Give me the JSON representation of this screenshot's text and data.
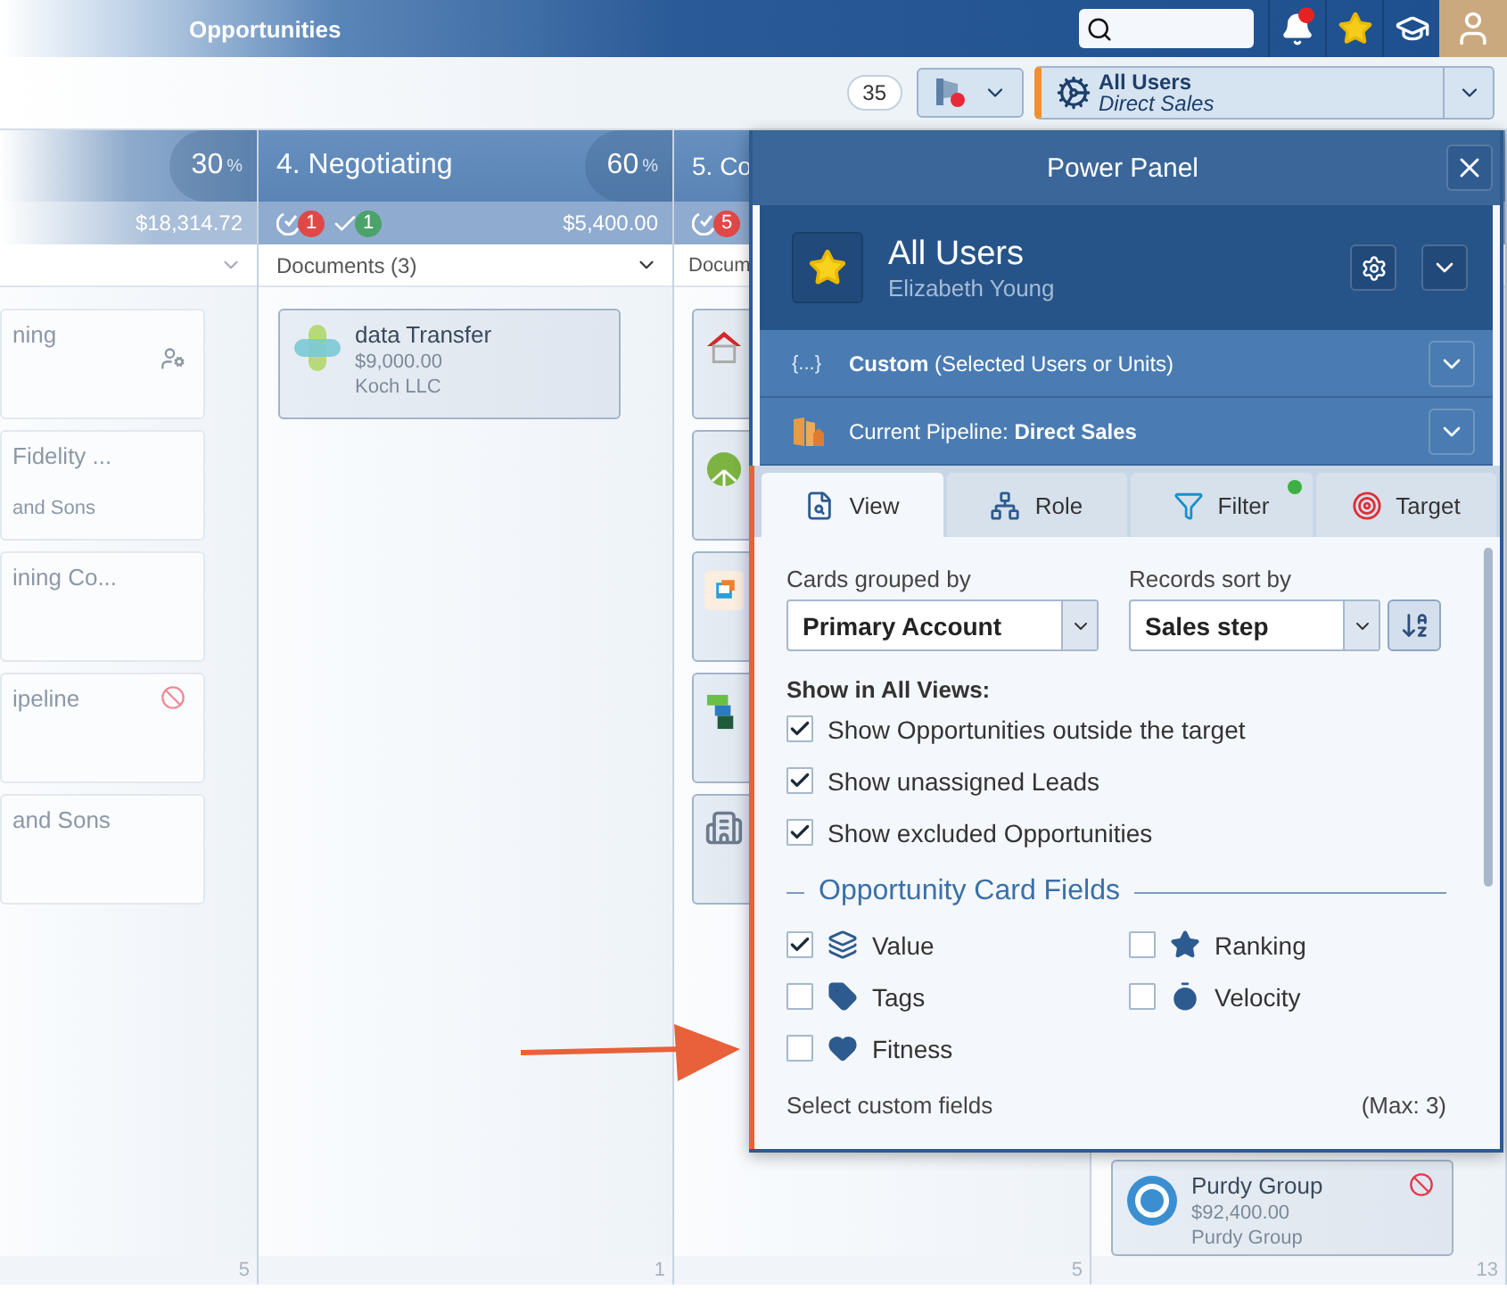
{
  "app_bar": {
    "title": "Opportunities",
    "notifications": {
      "unread": true
    }
  },
  "toolbar": {
    "count": "35",
    "user_selector": {
      "title": "All Users",
      "subtitle": "Direct Sales"
    }
  },
  "columns": [
    {
      "percent": "30",
      "percent_unit": "%",
      "amount": "$18,314.72",
      "count": "5",
      "cards": [
        {
          "title": "ning",
          "unassigned": true
        },
        {
          "title": "Fidelity ...",
          "account": "and Sons"
        },
        {
          "title": "ining Co..."
        },
        {
          "title": "ipeline",
          "excluded": true
        },
        {
          "title": "and Sons"
        }
      ]
    },
    {
      "title": "4. Negotiating",
      "percent": "60",
      "percent_unit": "%",
      "badges": [
        {
          "kind": "overdue",
          "count": "1"
        },
        {
          "kind": "done",
          "count": "1"
        }
      ],
      "amount": "$5,400.00",
      "documents": "Documents (3)",
      "count": "1",
      "cards": [
        {
          "title": "data Transfer",
          "value": "$9,000.00",
          "account": "Koch LLC",
          "kind": "cross"
        }
      ]
    },
    {
      "title": "5. Co",
      "badges": [
        {
          "kind": "overdue",
          "count": "5"
        }
      ],
      "documents": "Docum",
      "count": "5",
      "cards": [
        {
          "kind": "house"
        },
        {
          "kind": "leaf"
        },
        {
          "kind": "box"
        },
        {
          "kind": "blocks"
        },
        {
          "kind": "building"
        }
      ]
    },
    {
      "count": "13",
      "cards": [
        {
          "title": "Purdy Group",
          "value": "$92,400.00",
          "account": "Purdy Group",
          "kind": "ring",
          "excluded": true
        }
      ]
    }
  ],
  "power_panel": {
    "title": "Power Panel",
    "user": {
      "name": "All Users",
      "subtitle": "Elizabeth Young"
    },
    "scope_rows": [
      {
        "kind": "custom",
        "icon_text": "{...}",
        "text": "**Custom** (Selected Users or Units)"
      },
      {
        "kind": "pipeline",
        "text": "Current Pipeline: **Direct Sales**"
      }
    ],
    "tabs": [
      {
        "label": "View",
        "kind": "view",
        "selected": true
      },
      {
        "label": "Role",
        "kind": "role",
        "selected": false
      },
      {
        "label": "Filter",
        "kind": "filter",
        "selected": false,
        "indicator": true
      },
      {
        "label": "Target",
        "kind": "target",
        "selected": false
      }
    ],
    "grouped_by": {
      "label": "Cards grouped by",
      "value": "Primary Account"
    },
    "sort_by": {
      "label": "Records sort by",
      "value": "Sales step"
    },
    "show_all_views": {
      "heading": "Show in All Views:",
      "options": [
        {
          "label": "Show Opportunities outside the target",
          "checked": true
        },
        {
          "label": "Show unassigned Leads",
          "checked": true
        },
        {
          "label": "Show excluded Opportunities",
          "checked": true
        }
      ]
    },
    "card_fields": {
      "heading": "Opportunity Card Fields",
      "fields": [
        {
          "label": "Value",
          "kind": "value",
          "checked": true
        },
        {
          "label": "Ranking",
          "kind": "ranking",
          "checked": false
        },
        {
          "label": "Tags",
          "kind": "tags",
          "checked": false
        },
        {
          "label": "Velocity",
          "kind": "velocity",
          "checked": false
        },
        {
          "label": "Fitness",
          "kind": "fitness",
          "checked": false
        }
      ]
    },
    "custom_fields": {
      "label": "Select custom fields",
      "limit": "(Max: 3)"
    }
  }
}
